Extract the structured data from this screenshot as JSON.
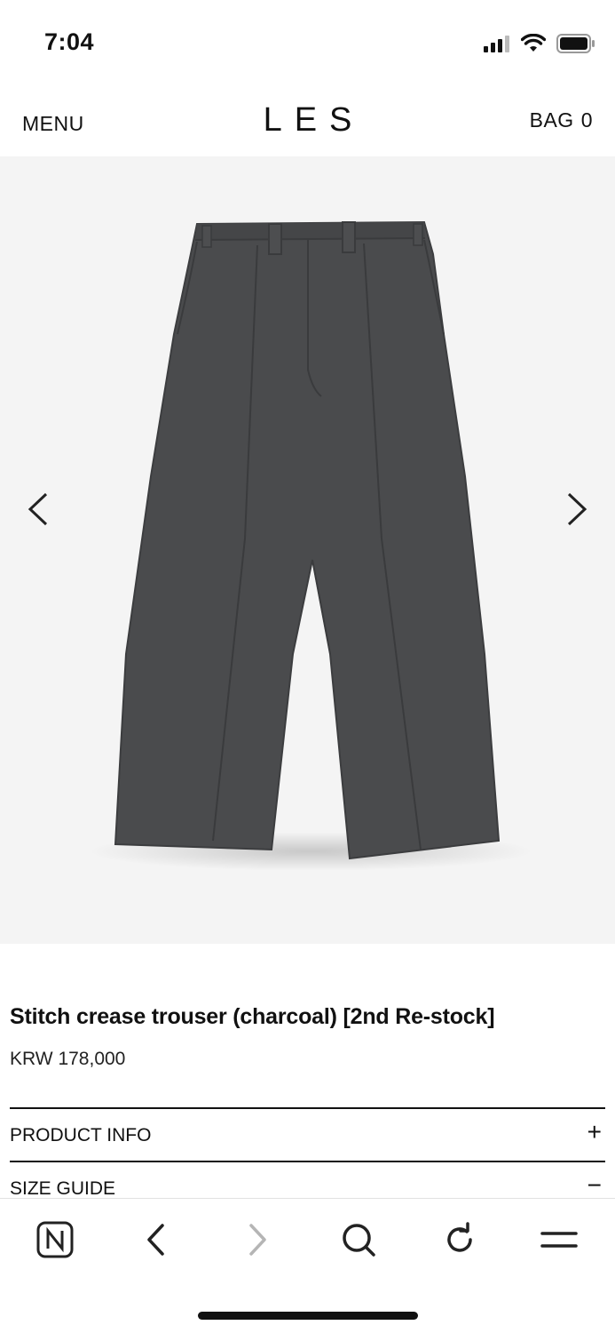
{
  "status_bar": {
    "time": "7:04",
    "icons": [
      "signal-icon",
      "wifi-icon",
      "battery-icon"
    ]
  },
  "header": {
    "menu_label": "MENU",
    "logo": "LES",
    "bag_label": "BAG",
    "bag_count": "0"
  },
  "gallery": {
    "image_subject": "charcoal trousers",
    "prev_icon": "chevron-left-icon",
    "next_icon": "chevron-right-icon"
  },
  "product": {
    "title": "Stitch crease trouser (charcoal) [2nd Re-stock]",
    "price": "KRW 178,000"
  },
  "accordion": [
    {
      "label": "PRODUCT INFO",
      "toggle": "+"
    },
    {
      "label": "SIZE GUIDE",
      "toggle": "−"
    }
  ],
  "browser_toolbar": {
    "items": [
      "naver-home-icon",
      "back-icon",
      "forward-icon",
      "search-icon",
      "refresh-icon",
      "menu-icon"
    ]
  },
  "colors": {
    "gallery_bg": "#f4f4f4",
    "product_color": "#4a4b4d",
    "text": "#111111",
    "disabled": "#b5b5b5"
  }
}
